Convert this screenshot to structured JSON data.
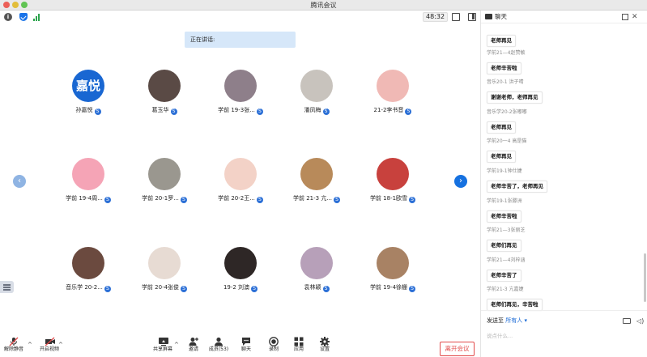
{
  "window": {
    "title": "腾讯会议"
  },
  "topbar": {
    "timer": "48:32"
  },
  "speaking": {
    "label": "正在讲话:"
  },
  "participants": [
    {
      "name": "孙嘉悦",
      "avatar_text": "嘉悦",
      "avatar_color": "#1967d2"
    },
    {
      "name": "葛玉华",
      "avatar_color": "#5a4a45"
    },
    {
      "name": "学前 19-3张...",
      "avatar_color": "#8e7f8a"
    },
    {
      "name": "潘凤梅",
      "avatar_color": "#c8c3bd"
    },
    {
      "name": "21-2李书音",
      "avatar_color": "#f0b9b5"
    },
    {
      "name": "学前 19-4周...",
      "avatar_color": "#f5a4b6"
    },
    {
      "name": "学前 20-1罗...",
      "avatar_color": "#9a978f"
    },
    {
      "name": "学前 20-2王...",
      "avatar_color": "#f3d2c7"
    },
    {
      "name": "学前 21-3 亢...",
      "avatar_color": "#b88a5a"
    },
    {
      "name": "学前 18-1欧雪",
      "avatar_color": "#c8413d"
    },
    {
      "name": "音乐学 20-2...",
      "avatar_color": "#6b4a3f"
    },
    {
      "name": "学前 20-4张俊",
      "avatar_color": "#e7dbd3"
    },
    {
      "name": "19-2 刘澳",
      "avatar_color": "#2e2726"
    },
    {
      "name": "袁林颖",
      "avatar_color": "#b7a0b9"
    },
    {
      "name": "学前 19-4徐栅",
      "avatar_color": "#a88264"
    }
  ],
  "toolbar": {
    "unmute": "解除静音",
    "video": "开启视频",
    "share": "共享屏幕",
    "invite": "邀请",
    "members": "成员(53)",
    "chat": "聊天",
    "record": "录制",
    "apps": "应用",
    "settings": "设置",
    "leave": "离开会议"
  },
  "chat": {
    "title": "聊天",
    "messages": [
      {
        "sender": "",
        "text": "老师再见"
      },
      {
        "sender": "学前21—4赵赞敏",
        "text": "老师辛苦啦"
      },
      {
        "sender": "音乐20-1 洪子晴",
        "text": "谢谢老师，老师再见"
      },
      {
        "sender": "音乐学20-2张嘟嘟",
        "text": "老师再见"
      },
      {
        "sender": "学前20一4 高是猫",
        "text": "老师再见"
      },
      {
        "sender": "学前19-1钟仕婕",
        "text": "老师辛苦了，老师再见"
      },
      {
        "sender": "学前19-1张滕洲",
        "text": "老师辛苦啦"
      },
      {
        "sender": "学前21—3张丽芝",
        "text": "老师们再见"
      },
      {
        "sender": "学前21—4刘梓涵",
        "text": "老师辛苦了"
      },
      {
        "sender": "学前21-3 亢嘉婕",
        "text": "老师们再见，辛苦啦"
      }
    ],
    "send_to_label": "发送至",
    "send_to_target": "所有人",
    "input_placeholder": "说点什么..."
  },
  "colors": {
    "accent": "#1671e0",
    "leave": "#e24b4b",
    "speaking_bg": "#d6e7f9"
  }
}
